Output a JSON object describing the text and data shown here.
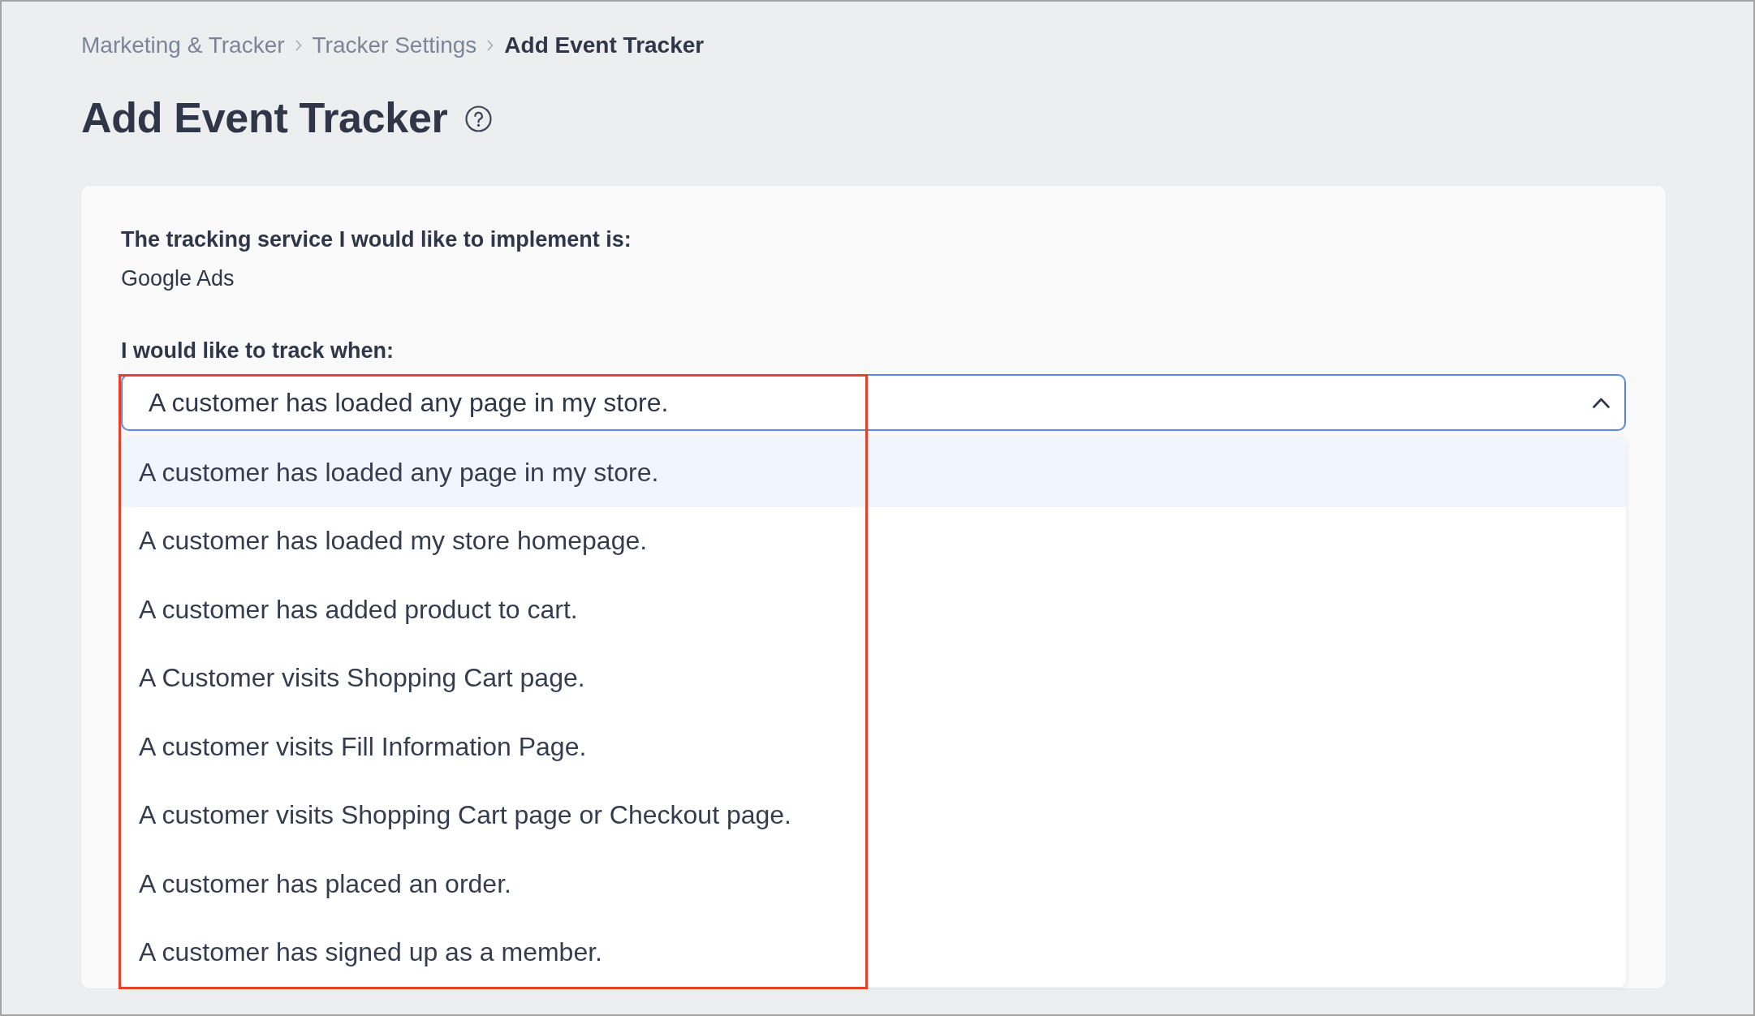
{
  "breadcrumb": [
    {
      "label": "Marketing & Tracker",
      "current": false
    },
    {
      "label": "Tracker Settings",
      "current": false
    },
    {
      "label": "Add Event Tracker",
      "current": true
    }
  ],
  "page_title": "Add Event Tracker",
  "form": {
    "service_label": "The tracking service I would like to implement is:",
    "service_value": "Google Ads",
    "trigger_label": "I would like to track when:",
    "trigger_select": {
      "value": "A customer has loaded any page in my store.",
      "expanded": true,
      "highlight": {
        "kind": "frame"
      },
      "options": [
        {
          "label": "A customer has loaded any page in my store.",
          "selected": true
        },
        {
          "label": "A customer has loaded my store homepage.",
          "selected": false
        },
        {
          "label": "A customer has added product to cart.",
          "selected": false
        },
        {
          "label": "A Customer visits Shopping Cart page.",
          "selected": false
        },
        {
          "label": "A customer visits Fill Information Page.",
          "selected": false
        },
        {
          "label": "A customer visits Shopping Cart page or Checkout page.",
          "selected": false
        },
        {
          "label": "A customer has placed an order.",
          "selected": false
        },
        {
          "label": "A customer has signed up as a member.",
          "selected": false
        }
      ]
    }
  }
}
